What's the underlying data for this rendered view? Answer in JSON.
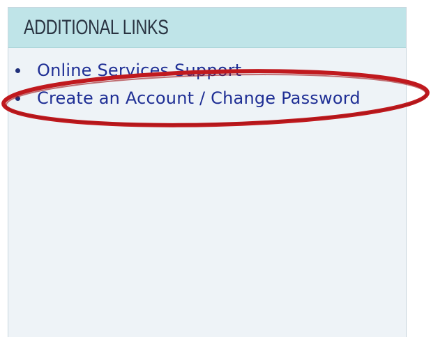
{
  "panel": {
    "title": "ADDITIONAL LINKS",
    "links": [
      {
        "label": "Online Services Support"
      },
      {
        "label": "Create an Account / Change Password"
      }
    ]
  },
  "annotation": {
    "shape": "ellipse",
    "color": "#c0191e",
    "highlights": "Create an Account / Change Password"
  },
  "colors": {
    "header_bg": "#bfe4e8",
    "panel_bg": "#eef3f7",
    "link": "#1f2f95",
    "title": "#2a3442"
  }
}
